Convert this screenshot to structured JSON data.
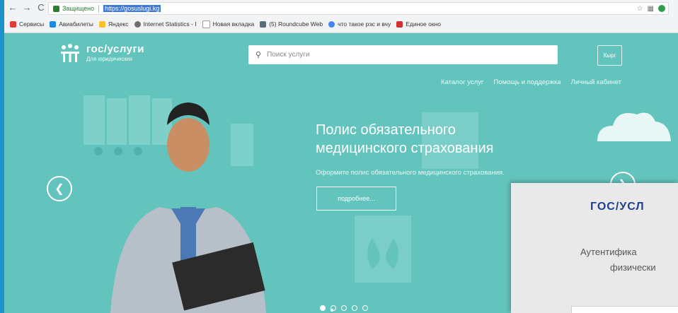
{
  "browser": {
    "secure_label": "Защищено",
    "url": "https://gosuslugi.kg",
    "bookmarks": [
      {
        "label": "Сервисы",
        "icon": "apps-icon",
        "color": "#e53935"
      },
      {
        "label": "Авиабилеты",
        "icon": "plane-icon",
        "color": "#1e88e5"
      },
      {
        "label": "Яндекс",
        "icon": "yandex-icon",
        "color": "#fbc02d"
      },
      {
        "label": "Internet Statistics - I",
        "icon": "globe-icon",
        "color": "#6d6d6d"
      },
      {
        "label": "Новая вкладка",
        "icon": "page-icon",
        "color": "#9e9e9e"
      },
      {
        "label": "(5) Roundcube Web",
        "icon": "mail-icon",
        "color": "#546e7a"
      },
      {
        "label": "что такое рэс и вчу",
        "icon": "google-icon",
        "color": "#4285f4"
      },
      {
        "label": "Единое окно",
        "icon": "flag-icon",
        "color": "#d32f2f"
      }
    ]
  },
  "site": {
    "logo_title": "гос/услуги",
    "logo_subtitle": "Для юридических",
    "search_placeholder": "Поиск услуги",
    "lang_button": "Кырг",
    "menu": [
      "Каталог услуг",
      "Помощь и поддержка",
      "Личный кабинет"
    ],
    "hero": {
      "title_line1": "Полис обязательного",
      "title_line2": "медицинского страхования",
      "subtitle": "Оформите полис обязательного медицинского страхования.",
      "more_button": "подробнее..."
    },
    "carousel_slides": 5,
    "carousel_active": 1
  },
  "overlay": {
    "title": "ГОС/УСЛ",
    "line1": "Аутентифика",
    "line2": "физически"
  },
  "colors": {
    "site_bg": "#63c4bd",
    "overlay_title": "#1f3f8f"
  }
}
